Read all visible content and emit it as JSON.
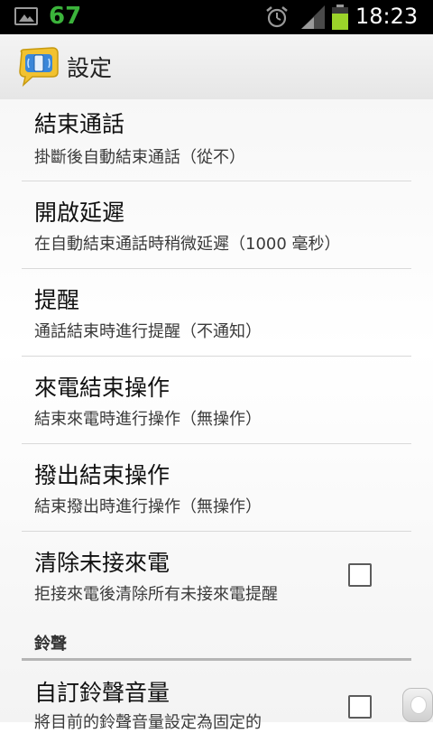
{
  "status_bar": {
    "notification_number": "67",
    "time": "18:23"
  },
  "action_bar": {
    "title": "設定"
  },
  "preferences": [
    {
      "title": "結束通話",
      "summary": "掛斷後自動結束通話（從不）",
      "checkbox": false
    },
    {
      "title": "開啟延遲",
      "summary": "在自動結束通話時稍微延遲（1000 毫秒）",
      "checkbox": false
    },
    {
      "title": "提醒",
      "summary": "通話結束時進行提醒（不通知）",
      "checkbox": false
    },
    {
      "title": "來電結束操作",
      "summary": "結束來電時進行操作（無操作）",
      "checkbox": false
    },
    {
      "title": "撥出結束操作",
      "summary": "結束撥出時進行操作（無操作）",
      "checkbox": false
    },
    {
      "title": "清除未接來電",
      "summary": "拒接來電後清除所有未接來電提醒",
      "checkbox": true,
      "checked": false
    }
  ],
  "section": {
    "header": "鈴聲"
  },
  "ringtone_item": {
    "title": "自訂鈴聲音量",
    "summary": "將目前的鈴聲音量設定為固定的",
    "checked": false
  },
  "colors": {
    "battery_green": "#3bb33b",
    "status_bar_bg": "#000000"
  }
}
